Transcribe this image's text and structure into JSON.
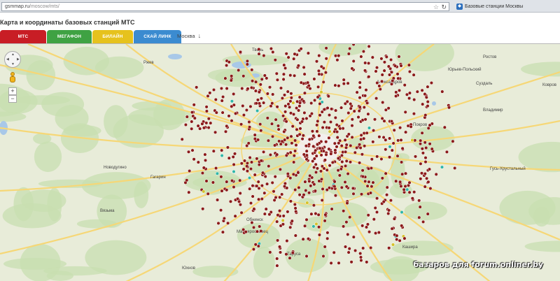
{
  "browser": {
    "url_main": "gsmmap.ru",
    "url_path": "/moscow/mts/",
    "tab_title": "Базовые станции Москвы",
    "tab_icon": "bookmark-icon"
  },
  "page": {
    "title": "Карта и координаты базовых станций МТС",
    "city": "Москва",
    "city_arrow": "↓"
  },
  "operators": [
    {
      "label": "МТС",
      "color": "#c81d25"
    },
    {
      "label": "МЕГАФОН",
      "color": "#3fa243"
    },
    {
      "label": "БИЛАЙН",
      "color": "#e6c21d"
    },
    {
      "label": "СКАЙ ЛИНК",
      "color": "#3b8bd0"
    }
  ],
  "map": {
    "controls": {
      "zoom_in": "+",
      "zoom_out": "−"
    },
    "colors": {
      "land": "#e8ecd9",
      "forest": "#c8dfb0",
      "water": "#a8c8e8",
      "road": "#f6d776",
      "marker": "#8b1a1a",
      "marker_highlight": "#2fb6a8",
      "marker_yellow": "#d4c22a"
    },
    "places": [
      {
        "name": "Новодугино"
      },
      {
        "name": "Гагарин"
      },
      {
        "name": "Вязьма"
      },
      {
        "name": "Обнинск"
      },
      {
        "name": "Малоярославец"
      },
      {
        "name": "Владимир"
      },
      {
        "name": "Гусь-Хрустальный"
      },
      {
        "name": "Александров"
      },
      {
        "name": "Юрьев-Польский"
      },
      {
        "name": "Суздаль"
      },
      {
        "name": "Ковров"
      },
      {
        "name": "Покров"
      },
      {
        "name": "Ржев"
      },
      {
        "name": "Тверь"
      },
      {
        "name": "Кашира"
      },
      {
        "name": "Таруса"
      },
      {
        "name": "Юхнов"
      },
      {
        "name": "Ростов"
      }
    ]
  },
  "watermark": "базаров для forum.onliner.by"
}
